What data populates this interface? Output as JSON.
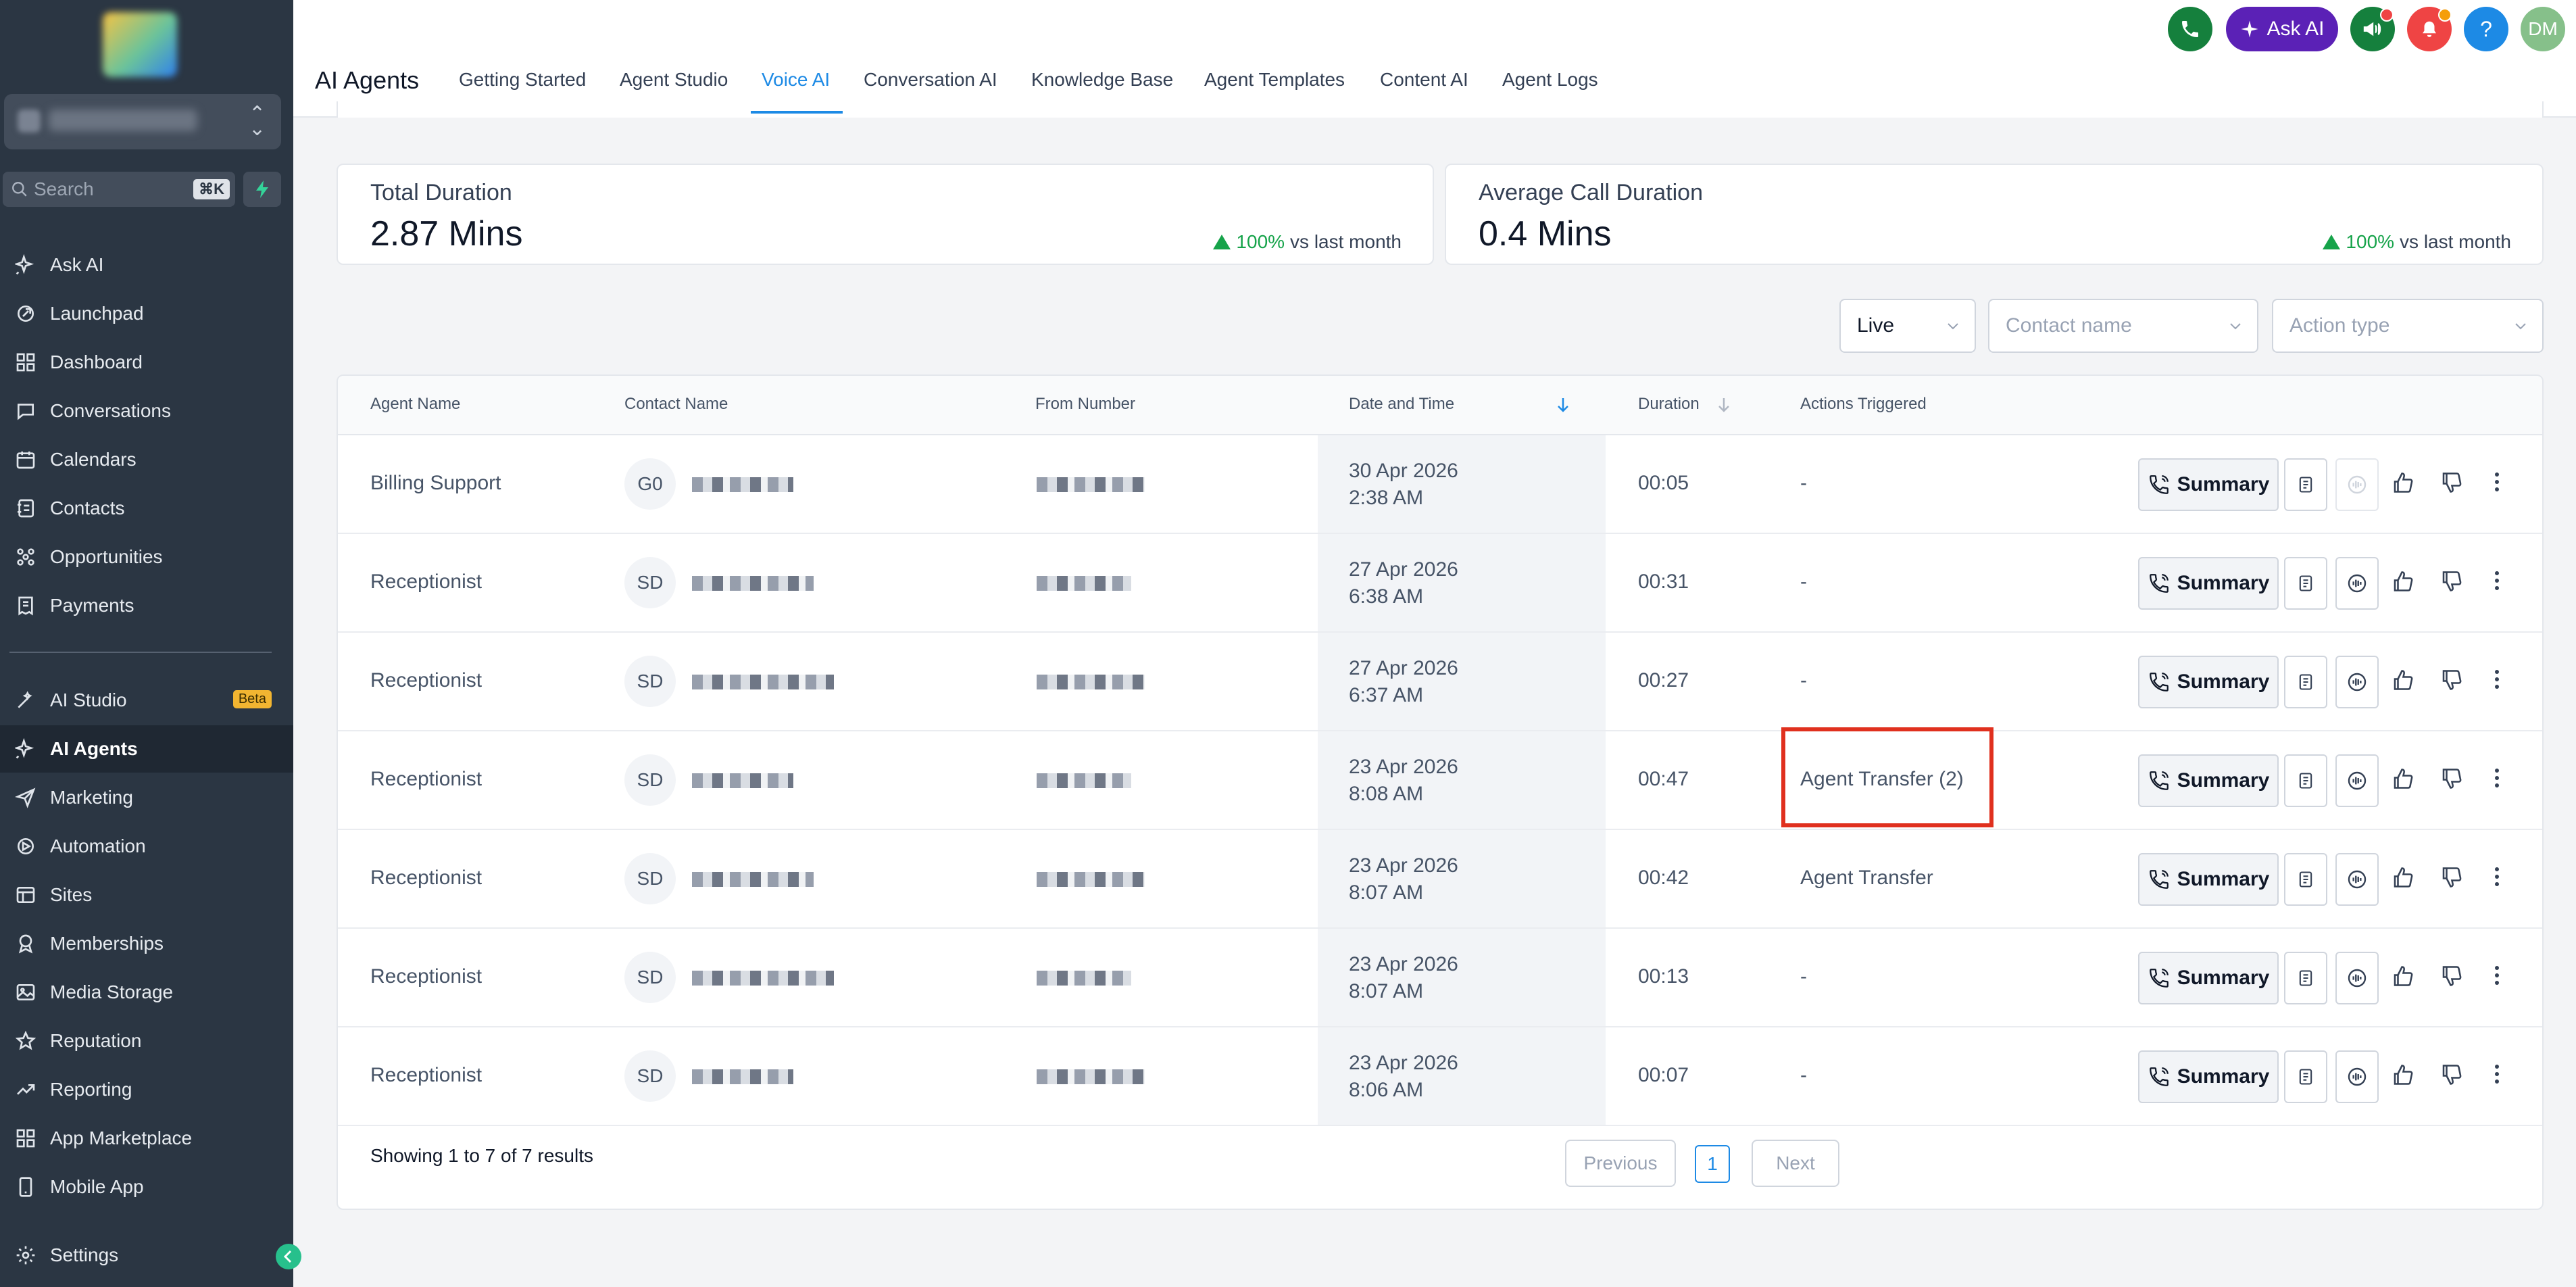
{
  "sidebar": {
    "search_placeholder": "Search",
    "search_shortcut": "⌘K",
    "items": [
      {
        "label": "Ask AI",
        "icon": "sparkle-icon"
      },
      {
        "label": "Launchpad",
        "icon": "rocket-icon"
      },
      {
        "label": "Dashboard",
        "icon": "grid-icon"
      },
      {
        "label": "Conversations",
        "icon": "chat-icon"
      },
      {
        "label": "Calendars",
        "icon": "calendar-icon"
      },
      {
        "label": "Contacts",
        "icon": "contacts-icon"
      },
      {
        "label": "Opportunities",
        "icon": "funnel-icon"
      },
      {
        "label": "Payments",
        "icon": "receipt-icon"
      },
      {
        "label": "AI Studio",
        "icon": "wand-icon",
        "badge": "Beta"
      },
      {
        "label": "AI Agents",
        "icon": "sparkle-icon",
        "active": true
      },
      {
        "label": "Marketing",
        "icon": "send-icon"
      },
      {
        "label": "Automation",
        "icon": "automation-icon"
      },
      {
        "label": "Sites",
        "icon": "globe-icon"
      },
      {
        "label": "Memberships",
        "icon": "medal-icon"
      },
      {
        "label": "Media Storage",
        "icon": "image-icon"
      },
      {
        "label": "Reputation",
        "icon": "star-icon"
      },
      {
        "label": "Reporting",
        "icon": "trend-icon"
      },
      {
        "label": "App Marketplace",
        "icon": "apps-icon"
      },
      {
        "label": "Mobile App",
        "icon": "phone-device-icon"
      },
      {
        "label": "Settings",
        "icon": "gear-icon"
      }
    ]
  },
  "header": {
    "title": "AI Agents",
    "tabs": [
      {
        "label": "Getting Started"
      },
      {
        "label": "Agent Studio"
      },
      {
        "label": "Voice AI",
        "active": true
      },
      {
        "label": "Conversation AI"
      },
      {
        "label": "Knowledge Base"
      },
      {
        "label": "Agent Templates"
      },
      {
        "label": "Content AI"
      },
      {
        "label": "Agent Logs"
      }
    ],
    "ask_ai_label": "Ask AI",
    "user_initials": "DM",
    "help_label": "?"
  },
  "stats": [
    {
      "title": "Total Duration",
      "value": "2.87 Mins",
      "change": "100%",
      "change_suffix": "vs last month"
    },
    {
      "title": "Average Call Duration",
      "value": "0.4 Mins",
      "change": "100%",
      "change_suffix": "vs last month"
    }
  ],
  "filters": {
    "status": "Live",
    "contact_placeholder": "Contact name",
    "action_placeholder": "Action type"
  },
  "table": {
    "columns": [
      "Agent Name",
      "Contact Name",
      "From Number",
      "Date and Time",
      "Duration",
      "Actions Triggered"
    ],
    "summary_label": "Summary",
    "rows": [
      {
        "agent": "Billing Support",
        "initials": "G0",
        "date": "30 Apr 2026",
        "time": "2:38 AM",
        "duration": "00:05",
        "actions": "-"
      },
      {
        "agent": "Receptionist",
        "initials": "SD",
        "date": "27 Apr 2026",
        "time": "6:38 AM",
        "duration": "00:31",
        "actions": "-"
      },
      {
        "agent": "Receptionist",
        "initials": "SD",
        "date": "27 Apr 2026",
        "time": "6:37 AM",
        "duration": "00:27",
        "actions": "-"
      },
      {
        "agent": "Receptionist",
        "initials": "SD",
        "date": "23 Apr 2026",
        "time": "8:08 AM",
        "duration": "00:47",
        "actions": "Agent Transfer (2)"
      },
      {
        "agent": "Receptionist",
        "initials": "SD",
        "date": "23 Apr 2026",
        "time": "8:07 AM",
        "duration": "00:42",
        "actions": "Agent Transfer"
      },
      {
        "agent": "Receptionist",
        "initials": "SD",
        "date": "23 Apr 2026",
        "time": "8:07 AM",
        "duration": "00:13",
        "actions": "-"
      },
      {
        "agent": "Receptionist",
        "initials": "SD",
        "date": "23 Apr 2026",
        "time": "8:06 AM",
        "duration": "00:07",
        "actions": "-"
      }
    ]
  },
  "pagination": {
    "showing": "Showing 1 to 7 of 7 results",
    "previous": "Previous",
    "page": "1",
    "next": "Next"
  },
  "colors": {
    "sidebar_bg": "#2b3643",
    "accent": "#1d8ae5",
    "ask_ai": "#5b21b6",
    "positive": "#16a34a",
    "highlight": "#e0301e"
  }
}
